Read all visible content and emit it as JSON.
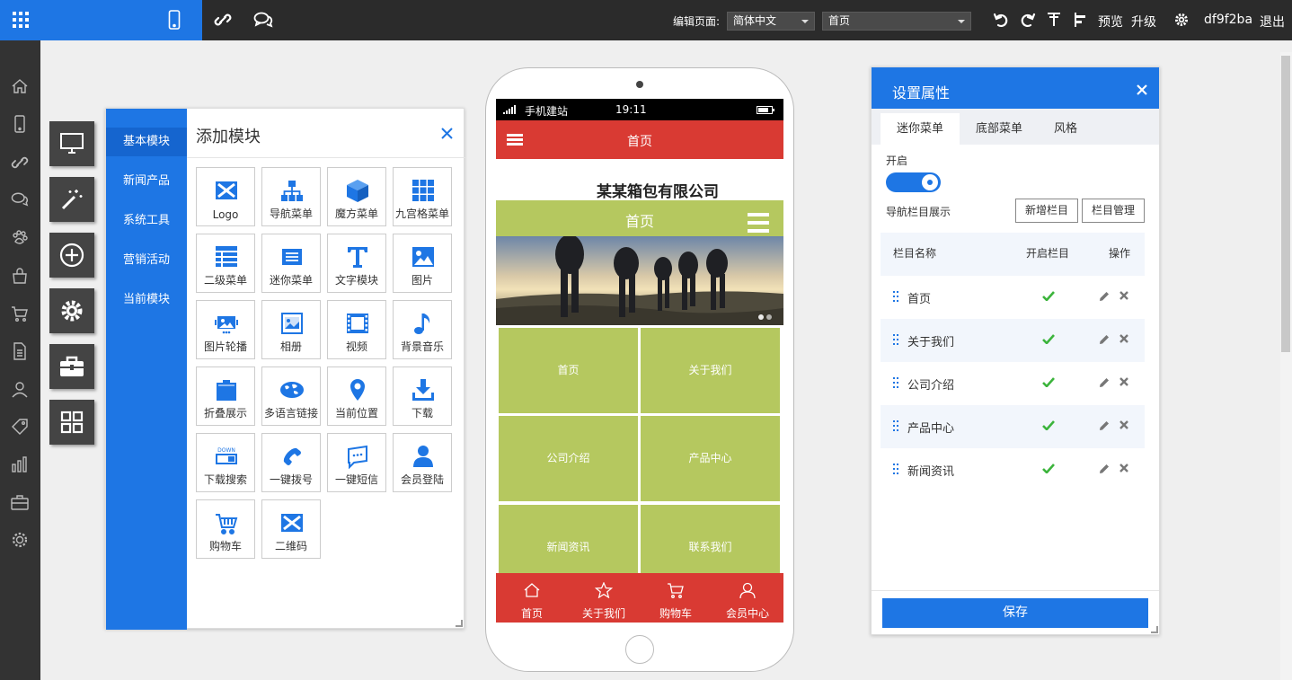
{
  "topbar": {
    "edit_page_label": "编辑页面:",
    "language_select": "简体中文",
    "page_select": "首页",
    "preview": "预览",
    "upgrade": "升级",
    "username": "df9f2ba",
    "logout": "退出"
  },
  "add_panel": {
    "title": "添加模块",
    "categories": [
      "基本模块",
      "新闻产品",
      "系统工具",
      "营销活动",
      "当前模块"
    ],
    "modules": [
      "Logo",
      "导航菜单",
      "魔方菜单",
      "九宫格菜单",
      "二级菜单",
      "迷你菜单",
      "文字模块",
      "图片",
      "图片轮播",
      "相册",
      "视频",
      "背景音乐",
      "折叠展示",
      "多语言链接",
      "当前位置",
      "下载",
      "下载搜索",
      "一键拨号",
      "一键短信",
      "会员登陆",
      "购物车",
      "二维码"
    ]
  },
  "phone": {
    "carrier": "手机建站",
    "time": "19:11",
    "appbar_title": "首页",
    "company": "某某箱包有限公司",
    "green_nav_title": "首页",
    "grid": [
      "首页",
      "关于我们",
      "公司介绍",
      "产品中心",
      "新闻资讯",
      "联系我们"
    ],
    "bottom_nav": [
      "首页",
      "关于我们",
      "购物车",
      "会员中心"
    ]
  },
  "props": {
    "title": "设置属性",
    "tabs": [
      "迷你菜单",
      "底部菜单",
      "风格"
    ],
    "open_label": "开启",
    "toggle_on": true,
    "nav_show_label": "导航栏目展示",
    "add_column": "新增栏目",
    "manage_column": "栏目管理",
    "table_headers": [
      "栏目名称",
      "开启栏目",
      "操作"
    ],
    "rows": [
      "首页",
      "关于我们",
      "公司介绍",
      "产品中心",
      "新闻资讯"
    ],
    "save": "保存"
  },
  "colors": {
    "primary": "#1e76e4",
    "phone_red": "#d93a33",
    "phone_green": "#b5c85f",
    "check_green": "#3cb43c"
  }
}
